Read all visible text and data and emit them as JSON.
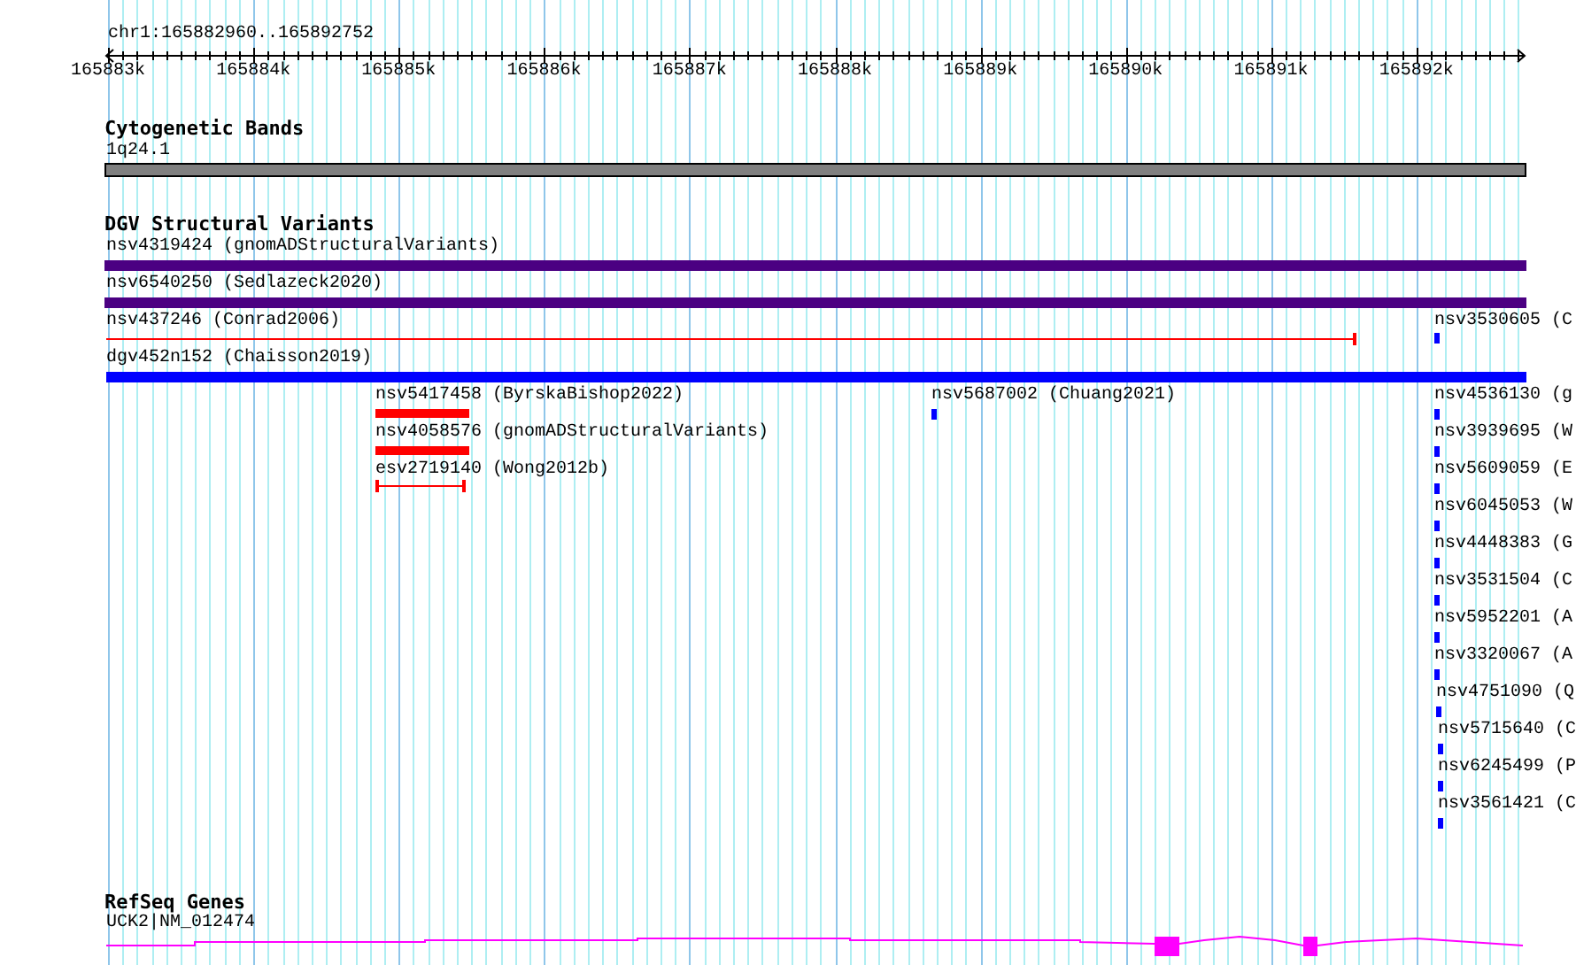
{
  "ruler": {
    "location": "chr1:165882960..165892752",
    "ticks": [
      "165883k",
      "165884k",
      "165885k",
      "165886k",
      "165887k",
      "165888k",
      "165889k",
      "165890k",
      "165891k",
      "165892k"
    ]
  },
  "tracks": [
    {
      "title": "Cytogenetic Bands",
      "kind": "bands",
      "label": "1q24.1"
    },
    {
      "title": "DGV Structural Variants",
      "kind": "variants",
      "features": [
        {
          "label": "nsv4319424 (gnomADStructuralVariants)",
          "kind": "bar",
          "color": "#4b0082"
        },
        {
          "label": "nsv6540250 (Sedlazeck2020)",
          "kind": "bar",
          "color": "#4b0082"
        },
        {
          "label": "nsv437246 (Conrad2006)",
          "kind": "span",
          "color": "#ff0000"
        },
        {
          "label": "nsv3530605 (C",
          "kind": "point",
          "color": "#0000ff"
        },
        {
          "label": "dgv452n152 (Chaisson2019)",
          "kind": "bar",
          "color": "#0000ff"
        },
        {
          "label": "nsv5417458 (ByrskaBishop2022)",
          "kind": "bar",
          "color": "#ff0000"
        },
        {
          "label": "nsv5687002 (Chuang2021)",
          "kind": "point",
          "color": "#0000ff"
        },
        {
          "label": "nsv4536130 (g",
          "kind": "point",
          "color": "#0000ff"
        },
        {
          "label": "nsv4058576 (gnomADStructuralVariants)",
          "kind": "bar",
          "color": "#ff0000"
        },
        {
          "label": "nsv3939695 (W",
          "kind": "point",
          "color": "#0000ff"
        },
        {
          "label": "esv2719140 (Wong2012b)",
          "kind": "span",
          "color": "#ff0000"
        },
        {
          "label": "nsv5609059 (E",
          "kind": "point",
          "color": "#0000ff"
        },
        {
          "label": "nsv6045053 (W",
          "kind": "point",
          "color": "#0000ff"
        },
        {
          "label": "nsv4448383 (G",
          "kind": "point",
          "color": "#0000ff"
        },
        {
          "label": "nsv3531504 (C",
          "kind": "point",
          "color": "#0000ff"
        },
        {
          "label": "nsv5952201 (A",
          "kind": "point",
          "color": "#0000ff"
        },
        {
          "label": "nsv3320067 (A",
          "kind": "point",
          "color": "#0000ff"
        },
        {
          "label": "nsv4751090 (Q",
          "kind": "point",
          "color": "#0000ff"
        },
        {
          "label": "nsv5715640 (C",
          "kind": "point",
          "color": "#0000ff"
        },
        {
          "label": "nsv6245499 (P",
          "kind": "point",
          "color": "#0000ff"
        },
        {
          "label": "nsv3561421 (C",
          "kind": "point",
          "color": "#0000ff"
        }
      ]
    },
    {
      "title": "RefSeq Genes",
      "kind": "genes",
      "label": "UCK2|NM_012474"
    }
  ]
}
